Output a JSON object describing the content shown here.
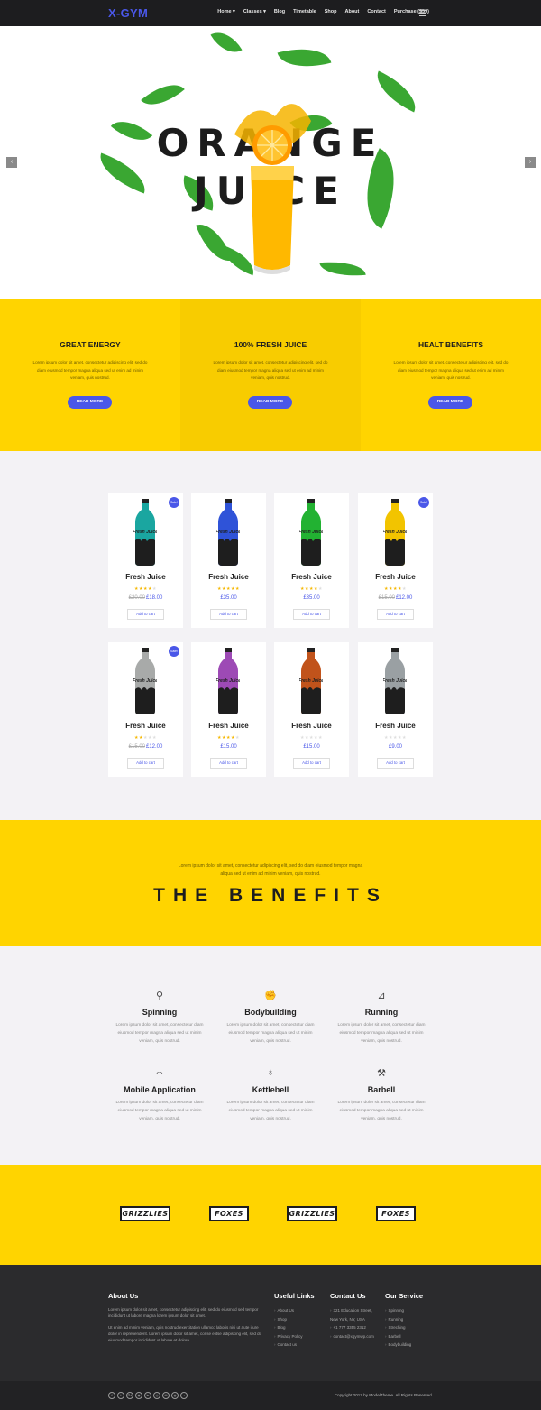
{
  "header": {
    "logo": "X-GYM",
    "nav": [
      "Home ▾",
      "Classes ▾",
      "Blog",
      "Timetable",
      "Shop",
      "About",
      "Contact",
      "Purchase ($59)"
    ]
  },
  "hero": {
    "title_line1": "ORANGE",
    "title_line2": "JUICE",
    "prev_label": "‹",
    "next_label": "›"
  },
  "features": [
    {
      "title": "GREAT ENERGY",
      "text": "Lorem ipsum dolor sit amet, consectetur adipiscing elit, sed do diam eiusmod tempor magna aliqua sed ut enim ad minim veniam, quis nostrud.",
      "button": "READ MORE"
    },
    {
      "title": "100% FRESH JUICE",
      "text": "Lorem ipsum dolor sit amet, consectetur adipiscing elit, sed do diam eiusmod tempor magna aliqua sed ut enim ad minim veniam, quis nostrud.",
      "button": "READ MORE"
    },
    {
      "title": "HEALT BENEFITS",
      "text": "Lorem ipsum dolor sit amet, consectetur adipiscing elit, sed do diam eiusmod tempor magna aliqua sed ut enim ad minim veniam, quis nostrud.",
      "button": "READ MORE"
    }
  ],
  "products": [
    {
      "name": "Fresh Juice",
      "old_price": "£20.00",
      "price": "£18.00",
      "rating": 4,
      "sale": true,
      "color": "#1aa6a0",
      "cart": "Add to cart"
    },
    {
      "name": "Fresh Juice",
      "old_price": "",
      "price": "£35.00",
      "rating": 5,
      "sale": false,
      "color": "#2f53d8",
      "cart": "Add to cart"
    },
    {
      "name": "Fresh Juice",
      "old_price": "",
      "price": "£35.00",
      "rating": 4,
      "sale": false,
      "color": "#22b232",
      "cart": "Add to cart"
    },
    {
      "name": "Fresh Juice",
      "old_price": "£15.00",
      "price": "£12.00",
      "rating": 4,
      "sale": true,
      "color": "#f2c400",
      "cart": "Add to cart"
    },
    {
      "name": "Fresh Juice",
      "old_price": "£15.00",
      "price": "£12.00",
      "rating": 2,
      "sale": true,
      "color": "#a8aaa9",
      "cart": "Add to cart"
    },
    {
      "name": "Fresh Juice",
      "old_price": "",
      "price": "£15.00",
      "rating": 4,
      "sale": false,
      "color": "#9d4ab5",
      "cart": "Add to cart"
    },
    {
      "name": "Fresh Juice",
      "old_price": "",
      "price": "£15.00",
      "rating": 0,
      "sale": false,
      "color": "#c1531b",
      "cart": "Add to cart"
    },
    {
      "name": "Fresh Juice",
      "old_price": "",
      "price": "£9.00",
      "rating": 0,
      "sale": false,
      "color": "#9aa0a3",
      "cart": "Add to cart"
    }
  ],
  "sale_label": "Sale!",
  "bottle_label": "Fresh Juice",
  "benefits": {
    "intro": "Lorem ipsum dolor sit amet, consectetur adipiscing elit, sed do diam eiusmod tempor magna aliqua sed ut enim ad minim veniam, quis nostrud.",
    "title": "THE BENEFITS"
  },
  "services": [
    {
      "icon": "spinning-bike-icon",
      "glyph": "⚲",
      "title": "Spinning",
      "text": "Lorem ipsum dolor sit amet, consectetur diam eiusmod tempor magna aliqua sed ut minim veniam, quis nostrud."
    },
    {
      "icon": "bicep-icon",
      "glyph": "✊",
      "title": "Bodybuilding",
      "text": "Lorem ipsum dolor sit amet, consectetur diam eiusmod tempor magna aliqua sed ut minim veniam, quis nostrud."
    },
    {
      "icon": "treadmill-icon",
      "glyph": "⊿",
      "title": "Running",
      "text": "Lorem ipsum dolor sit amet, consectetur diam eiusmod tempor magna aliqua sed ut minim veniam, quis nostrud."
    },
    {
      "icon": "mobile-icon",
      "glyph": "⇔",
      "title": "Mobile Application",
      "text": "Lorem ipsum dolor sit amet, consectetur diam eiusmod tempor magna aliqua sed ut minim veniam, quis nostrud."
    },
    {
      "icon": "kettlebell-icon",
      "glyph": "♁",
      "title": "Kettlebell",
      "text": "Lorem ipsum dolor sit amet, consectetur diam eiusmod tempor magna aliqua sed ut minim veniam, quis nostrud."
    },
    {
      "icon": "barbell-icon",
      "glyph": "⚒",
      "title": "Barbell",
      "text": "Lorem ipsum dolor sit amet, consectetur diam eiusmod tempor magna aliqua sed ut minim veniam, quis nostrud."
    }
  ],
  "team_logos": [
    "GRIZZLIES",
    "FOXES",
    "GRIZZLIES",
    "FOXES"
  ],
  "footer": {
    "about_title": "About Us",
    "about_p1": "Lorem ipsum dolor sit amet, consectetur adipiscing elit, sed do eiusmod sed tempor incididunt ut labore magna lorem ipsum dolor sit amet.",
    "about_p2": "Ut enim ad minim veniam, quis nostrud exercitation ullamco laboris nisi ut aute irure dolor in reprehenderit. Lorem ipsum dolor sit amet, conse elitse adipiscing elit, sed do eiusmod tempor incididunt ut labore et dolore.",
    "links_title": "Useful Links",
    "links": [
      "About Us",
      "Shop",
      "Blog",
      "Privacy Policy",
      "Contact us"
    ],
    "contact_title": "Contact Us",
    "contact": [
      "321 Education Street, New York, NY, USA",
      "+1 777 3355 2312",
      "contact@xgymwp.com"
    ],
    "service_title": "Our Service",
    "service_links": [
      "Spinning",
      "Running",
      "Streching",
      "Barbell",
      "Bodybuilding"
    ]
  },
  "bottombar": {
    "social": [
      "f",
      "t",
      "G+",
      "◉",
      "in",
      "◎",
      "✉",
      "◍",
      "♪"
    ],
    "copyright": "Copyright 2017 by ModelTheme. All Rights Reserved."
  }
}
